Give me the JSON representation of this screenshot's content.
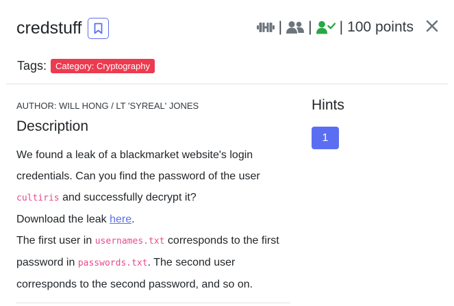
{
  "challenge": {
    "title": "credstuff",
    "points_label": "100 points",
    "tags_label": "Tags:",
    "tag": "Category: Cryptography",
    "author": "AUTHOR: WILL HONG / LT 'SYREAL' JONES",
    "description_heading": "Description",
    "description": {
      "line1": "We found a leak of a blackmarket website's login credentials. Can you find the password of the user",
      "user_code": "cultiris",
      "line1_end": "and successfully decrypt it?",
      "download_prefix": "Download the leak",
      "download_link": "here",
      "download_suffix": ".",
      "p3_a": "The first user in",
      "p3_code1": "usernames.txt",
      "p3_b": "corresponds to the first password in",
      "p3_code2": "passwords.txt",
      "p3_c": ". The second user corresponds to the second password, and so on."
    }
  },
  "hints": {
    "heading": "Hints",
    "items": [
      "1"
    ]
  },
  "icons": {
    "difficulty": "dumbbell-icon",
    "solvers": "users-icon",
    "solved_status": "user-check-icon",
    "bookmark": "bookmark-icon",
    "close": "close-icon"
  },
  "colors": {
    "accent": "#5a6ff0",
    "tag_bg": "#ec3a4f",
    "code": "#e8498b",
    "solved": "#28a745",
    "icon_gray": "#6c757d"
  }
}
